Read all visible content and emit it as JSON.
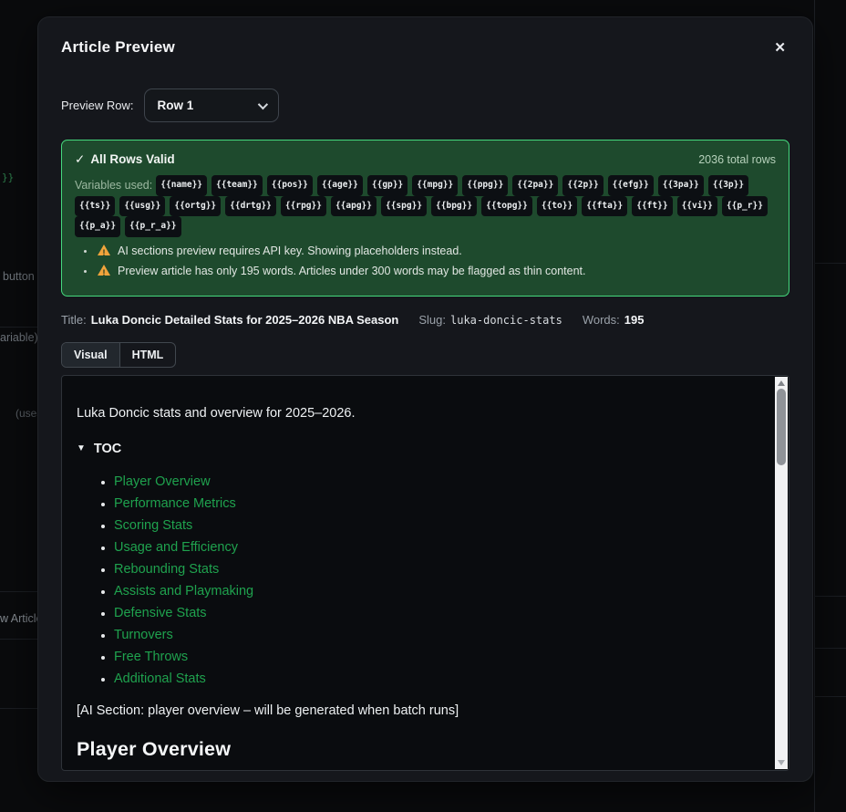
{
  "modal": {
    "title": "Article Preview",
    "close_icon": "✕",
    "preview_row_label": "Preview Row:",
    "row_select_value": "Row 1"
  },
  "validation": {
    "check_icon": "✓",
    "status": "All Rows Valid",
    "total_rows": "2036 total rows",
    "variables_label": "Variables used:",
    "variables": [
      "{{name}}",
      "{{team}}",
      "{{pos}}",
      "{{age}}",
      "{{gp}}",
      "{{mpg}}",
      "{{ppg}}",
      "{{2pa}}",
      "{{2p}}",
      "{{efg}}",
      "{{3pa}}",
      "{{3p}}",
      "{{ts}}",
      "{{usg}}",
      "{{ortg}}",
      "{{drtg}}",
      "{{rpg}}",
      "{{apg}}",
      "{{spg}}",
      "{{bpg}}",
      "{{topg}}",
      "{{to}}",
      "{{fta}}",
      "{{ft}}",
      "{{vi}}",
      "{{p_r}}",
      "{{p_a}}",
      "{{p_r_a}}"
    ],
    "warnings": [
      "AI sections preview requires API key. Showing placeholders instead.",
      "Preview article has only 195 words. Articles under 300 words may be flagged as thin content."
    ]
  },
  "meta": {
    "title_label": "Title:",
    "title_value": "Luka Doncic Detailed Stats for 2025–2026 NBA Season",
    "slug_label": "Slug:",
    "slug_value": "luka-doncic-stats",
    "words_label": "Words:",
    "words_value": "195"
  },
  "tabs": [
    {
      "label": "Visual"
    },
    {
      "label": "HTML"
    }
  ],
  "preview": {
    "intro": "Luka Doncic stats and overview for 2025–2026.",
    "toc_toggle": "▼",
    "toc_label": "TOC",
    "toc_items": [
      "Player Overview",
      "Performance Metrics",
      "Scoring Stats",
      "Usage and Efficiency",
      "Rebounding Stats",
      "Assists and Playmaking",
      "Defensive Stats",
      "Turnovers",
      "Free Throws",
      "Additional Stats"
    ],
    "ai_placeholder": "[AI Section: player overview – will be generated when batch runs]",
    "section_heading": "Player Overview"
  },
  "background": {
    "fragments": [
      "}}",
      "button",
      "ariable)",
      "(uses +",
      "w Article"
    ]
  },
  "colors": {
    "accent_green_border": "#45d97e",
    "valid_box_bg": "#1e4a2d",
    "toc_link_green": "#1fa24e",
    "warning_orange": "#f0a43c",
    "modal_bg": "#15171c"
  }
}
